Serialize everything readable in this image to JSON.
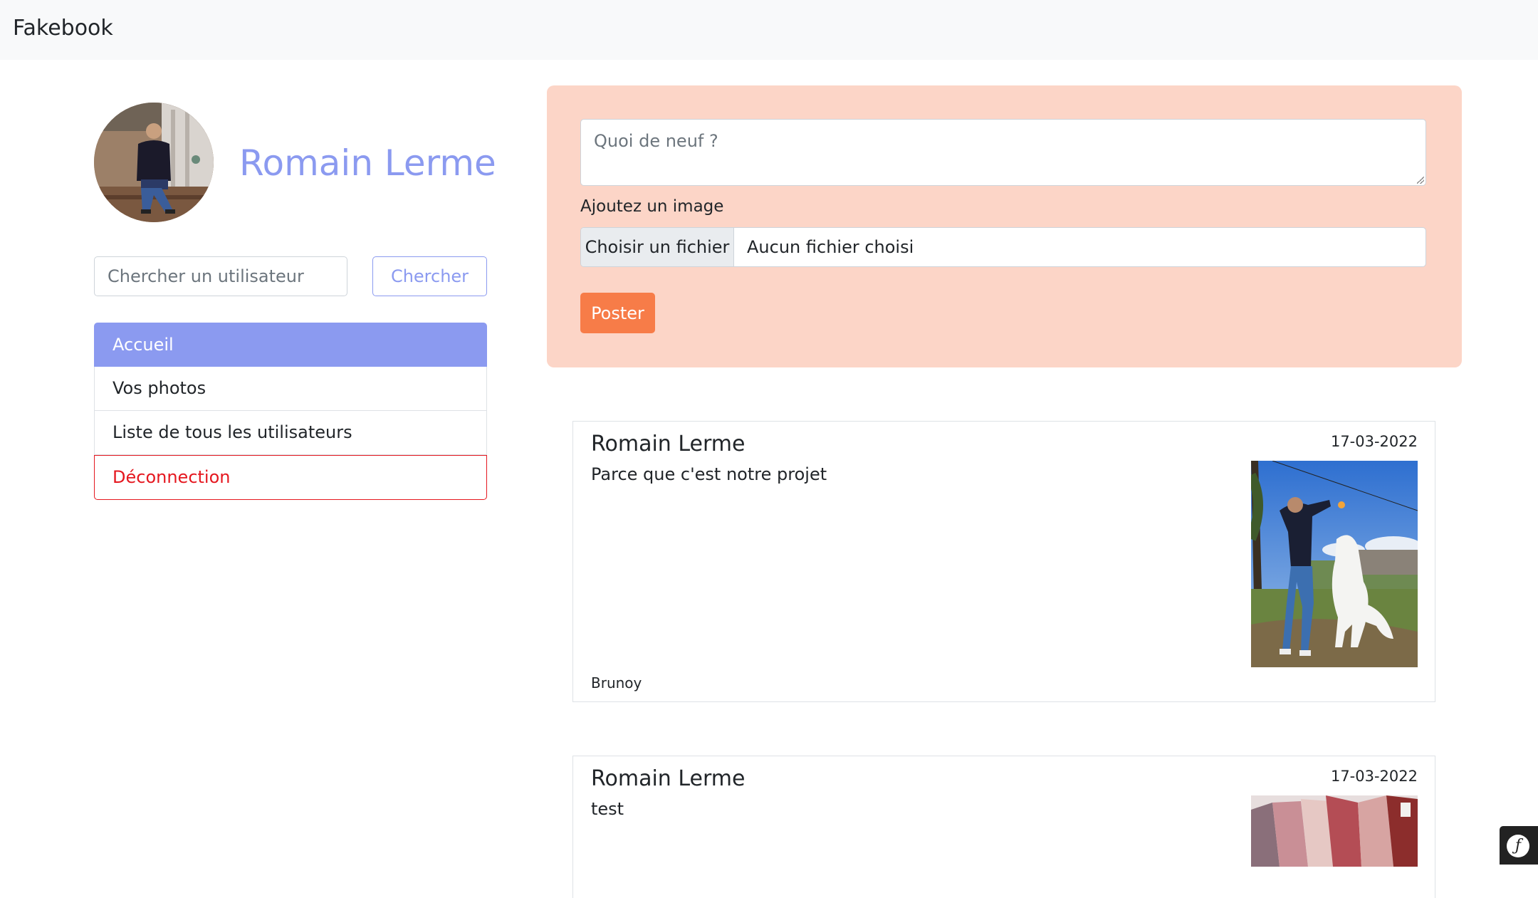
{
  "navbar": {
    "brand": "Fakebook"
  },
  "profile": {
    "name": "Romain Lerme"
  },
  "search": {
    "placeholder": "Chercher un utilisateur",
    "button_label": "Chercher"
  },
  "menu": {
    "items": [
      {
        "label": "Accueil",
        "state": "active"
      },
      {
        "label": "Vos photos",
        "state": "default"
      },
      {
        "label": "Liste de tous les utilisateurs",
        "state": "default"
      },
      {
        "label": "Déconnection",
        "state": "danger"
      }
    ]
  },
  "composer": {
    "placeholder": "Quoi de neuf ?",
    "image_label": "Ajoutez un image",
    "file_button_label": "Choisir un fichier",
    "file_status": "Aucun fichier choisi",
    "submit_label": "Poster"
  },
  "posts": [
    {
      "author": "Romain Lerme",
      "date": "17-03-2022",
      "text": "Parce que c'est notre projet",
      "location": "Brunoy"
    },
    {
      "author": "Romain Lerme",
      "date": "17-03-2022",
      "text": "test",
      "location": ""
    }
  ],
  "colors": {
    "accent": "#8b9af0",
    "danger": "#e5171f",
    "composer_bg": "#fcd5c7",
    "post_button": "#f77c48"
  },
  "icons": {
    "profiler": "symfony-icon"
  }
}
